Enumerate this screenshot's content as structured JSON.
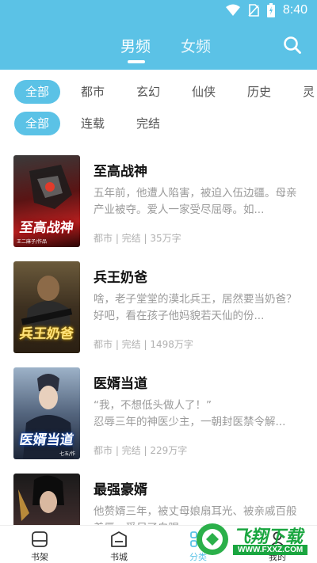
{
  "status": {
    "time": "8:40"
  },
  "header": {
    "tabs": [
      {
        "label": "男频",
        "active": true
      },
      {
        "label": "女频",
        "active": false
      }
    ]
  },
  "filters": {
    "categories": [
      "全部",
      "都市",
      "玄幻",
      "仙侠",
      "历史",
      "灵"
    ],
    "status": [
      "全部",
      "连载",
      "完结"
    ]
  },
  "books": [
    {
      "title": "至高战神",
      "desc": "五年前，他遭人陷害，被迫入伍边疆。母亲产业被夺。爱人一家受尽屈辱。如...",
      "meta": "都市 | 完结 | 35万字",
      "cover_text": "至高战神",
      "cover_subtext": "王二麻子/作品"
    },
    {
      "title": "兵王奶爸",
      "desc": "啥，老子堂堂的漠北兵王，居然要当奶爸？好吧，看在孩子他妈貌若天仙的份...",
      "meta": "都市 | 完结 | 1498万字",
      "cover_text": "兵王奶爸",
      "cover_subtext": ""
    },
    {
      "title": "医婿当道",
      "desc": "“我，不想低头做人了！”\n忍辱三年的神医少主，一朝封医禁令解...",
      "meta": "都市 | 完结 | 229万字",
      "cover_text": "医婿当道",
      "cover_subtext": "七五/作"
    },
    {
      "title": "最强豪婿",
      "desc": "他赘婿三年，被丈母娘扇耳光、被亲戚百般羞辱，受尽了白眼...",
      "meta": "",
      "cover_text": "",
      "cover_subtext": ""
    }
  ],
  "bottom_nav": [
    {
      "label": "书架",
      "icon": "bookshelf-icon",
      "active": false
    },
    {
      "label": "书城",
      "icon": "bookstore-icon",
      "active": false
    },
    {
      "label": "分类",
      "icon": "category-icon",
      "active": true
    },
    {
      "label": "我的",
      "icon": "profile-icon",
      "active": false
    }
  ],
  "watermark": {
    "text": "飞翔下载",
    "url": "WWW.FXXZ.COM"
  },
  "colors": {
    "accent": "#5bc2e6"
  }
}
